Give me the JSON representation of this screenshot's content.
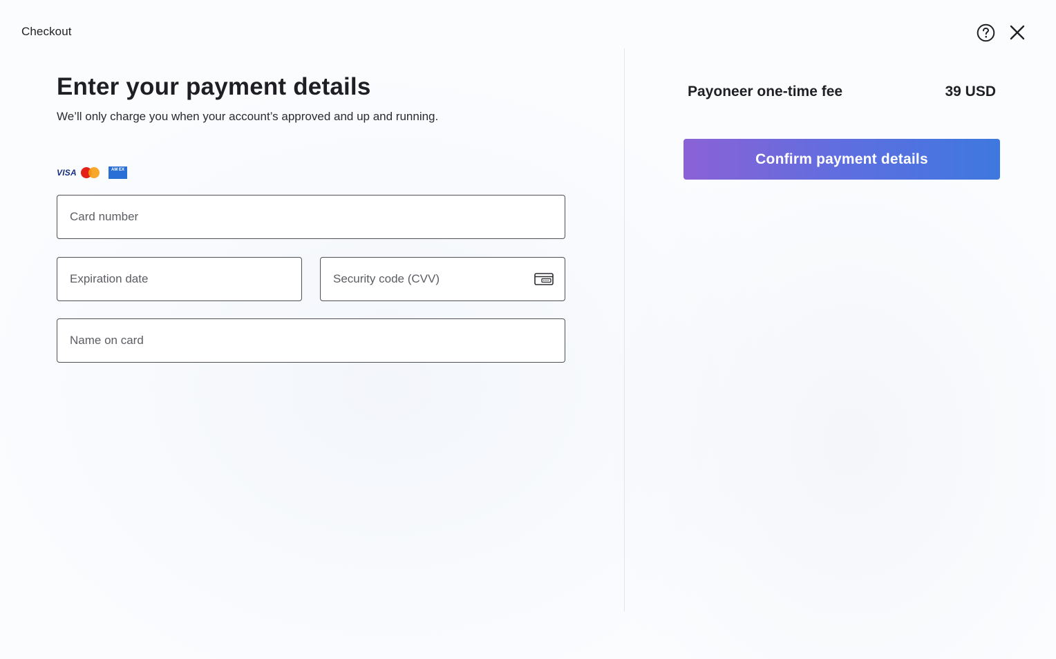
{
  "header": {
    "title": "Checkout",
    "help_icon": "help-circle-icon",
    "close_icon": "close-icon"
  },
  "main": {
    "heading": "Enter your payment details",
    "subheading": "We’ll only charge you when your account’s approved and up and running.",
    "card_brands": {
      "visa": "VISA",
      "mastercard": "mastercard-logo",
      "amex": "AM EX"
    },
    "form": {
      "card_number_placeholder": "Card number",
      "expiration_placeholder": "Expiration date",
      "cvv_placeholder": "Security code (CVV)",
      "cvv_icon": "card-cvv-icon",
      "name_placeholder": "Name on card"
    }
  },
  "summary": {
    "fee_label": "Payoneer one-time fee",
    "fee_amount": "39 USD",
    "confirm_label": "Confirm payment details"
  },
  "colors": {
    "accent_start": "#8a62d6",
    "accent_end": "#3e78df",
    "border": "#4d4f55",
    "divider": "#e3e5ea"
  }
}
